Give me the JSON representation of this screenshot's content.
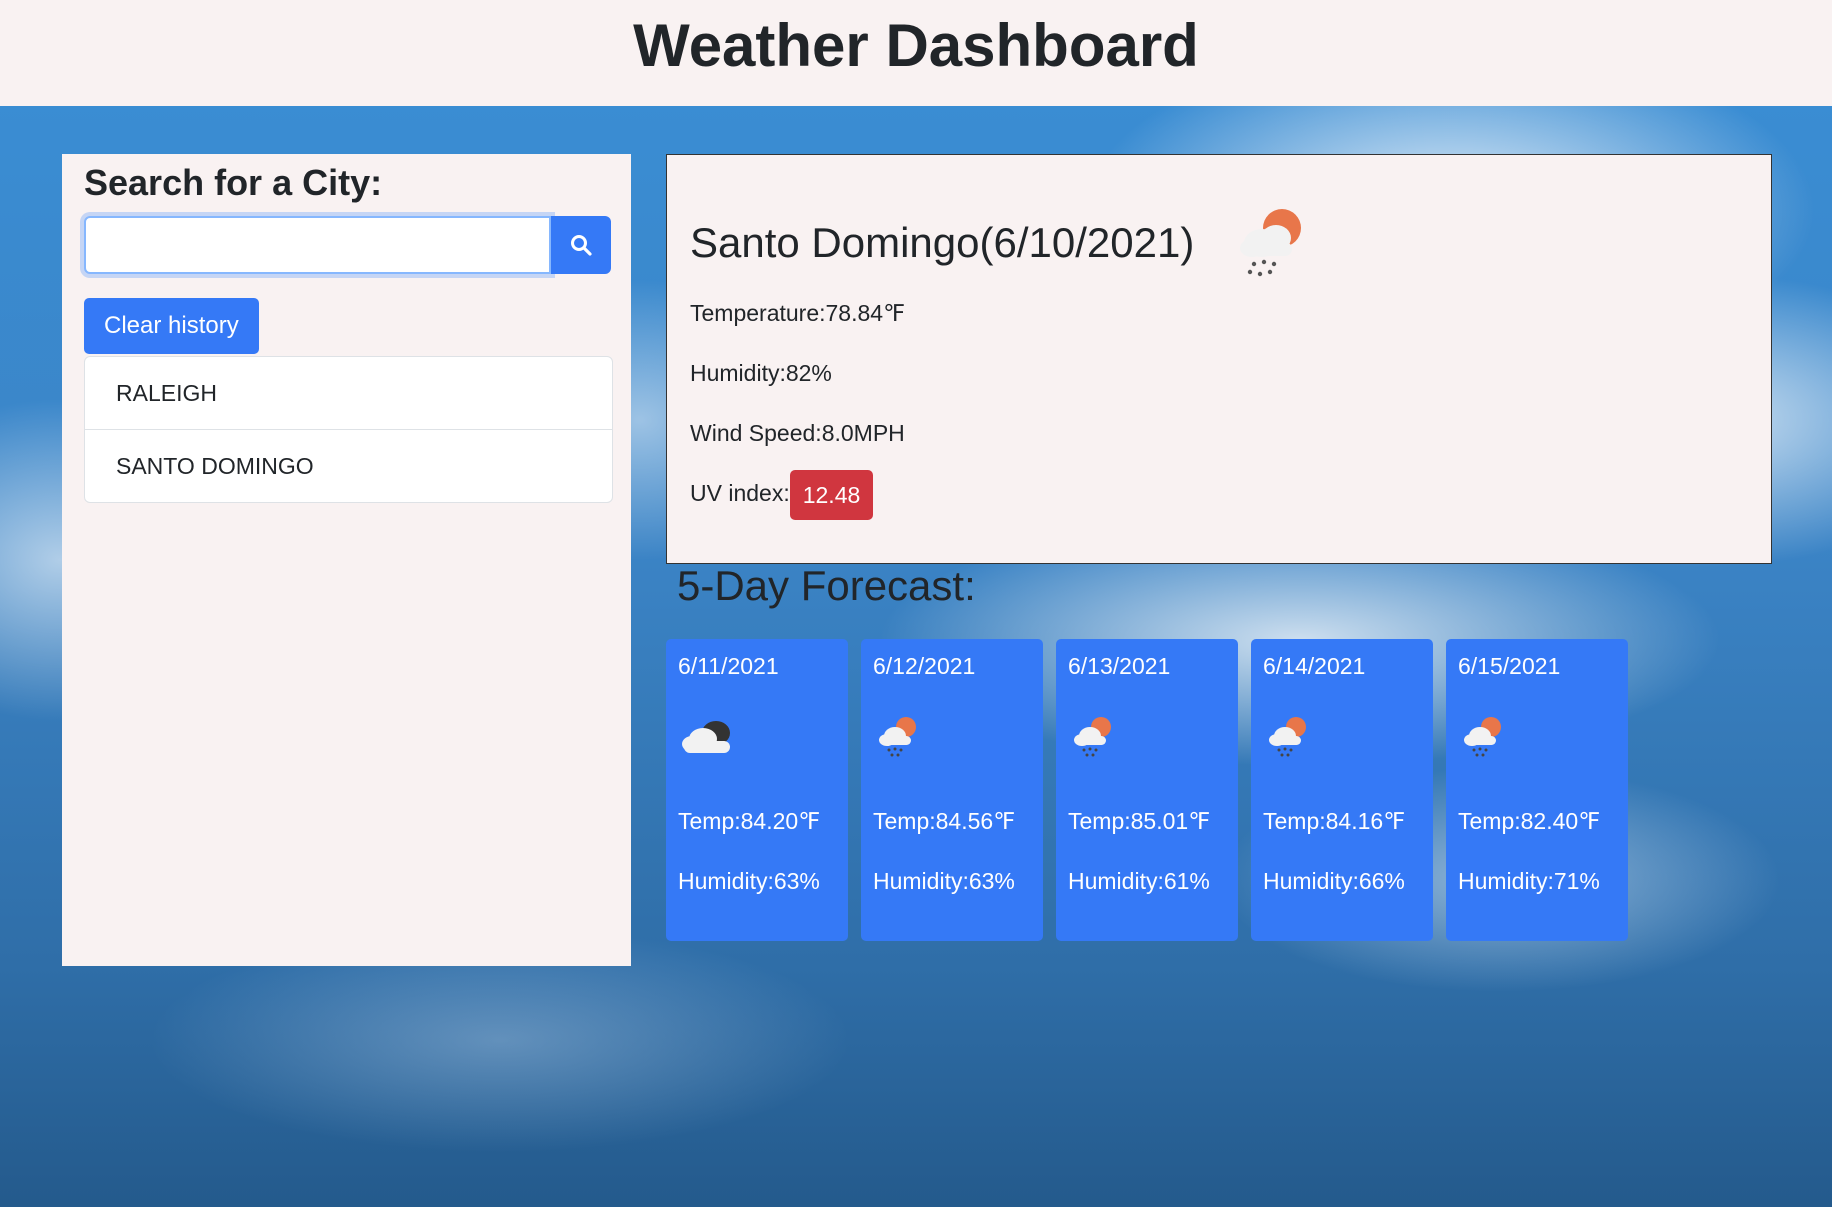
{
  "header": {
    "title": "Weather Dashboard"
  },
  "search": {
    "heading": "Search for a City:",
    "input_value": "",
    "button_icon": "search-icon",
    "clear_label": "Clear history",
    "history": [
      "RALEIGH",
      "SANTO DOMINGO"
    ]
  },
  "current": {
    "title": "Santo Domingo(6/10/2021)",
    "icon": "rain-partly-sunny-icon",
    "temperature": "Temperature:78.84℉",
    "humidity": "Humidity:82%",
    "wind": "Wind Speed:8.0MPH",
    "uv_label": "UV index:",
    "uv_value": "12.48"
  },
  "forecast": {
    "title": "5-Day Forecast:",
    "days": [
      {
        "date": "6/11/2021",
        "icon": "cloudy-icon",
        "temp": "Temp:84.20℉",
        "humidity": "Humidity:63%"
      },
      {
        "date": "6/12/2021",
        "icon": "rain-partly-sunny-icon",
        "temp": "Temp:84.56℉",
        "humidity": "Humidity:63%"
      },
      {
        "date": "6/13/2021",
        "icon": "rain-partly-sunny-icon",
        "temp": "Temp:85.01℉",
        "humidity": "Humidity:61%"
      },
      {
        "date": "6/14/2021",
        "icon": "rain-partly-sunny-icon",
        "temp": "Temp:84.16℉",
        "humidity": "Humidity:66%"
      },
      {
        "date": "6/15/2021",
        "icon": "rain-partly-sunny-icon",
        "temp": "Temp:82.40℉",
        "humidity": "Humidity:71%"
      }
    ]
  },
  "colors": {
    "accent": "#3579f6",
    "uv_badge": "#d0363f",
    "panel": "#f9f2f2"
  }
}
